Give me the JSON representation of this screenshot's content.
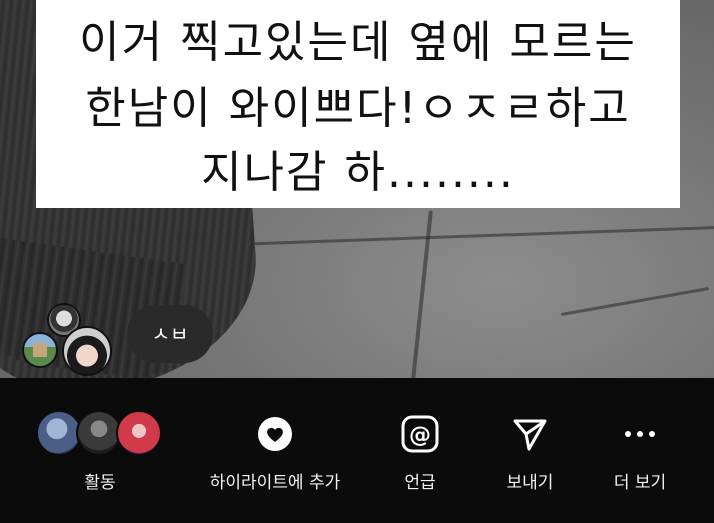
{
  "caption": {
    "line1": "이거 찍고있는데 옆에 모르는",
    "line2": "한남이 와이쁘다!ㅇㅈㄹ하고",
    "line3": "지나감 하........"
  },
  "reply_bubble": {
    "text": "ㅅㅂ"
  },
  "bottom_bar": {
    "activity_label": "활동",
    "highlight_label": "하이라이트에 추가",
    "mention_label": "언급",
    "send_label": "보내기",
    "more_label": "더 보기"
  },
  "icons": {
    "heart": "heart-icon",
    "mention": "at-sign-icon",
    "send": "paper-plane-icon",
    "more": "more-dots-icon"
  },
  "colors": {
    "bar_background": "#0b0b0b",
    "caption_background": "#ffffff",
    "text_light": "#f2f2f2"
  }
}
